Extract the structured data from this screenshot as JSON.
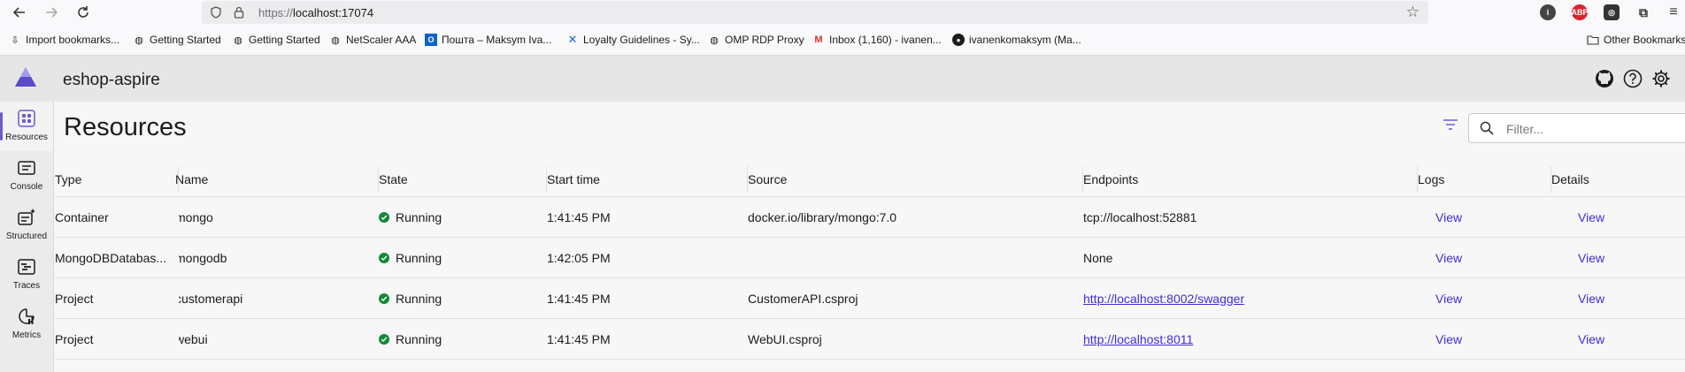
{
  "browser": {
    "url_prefix": "https://",
    "url_host": "localhost:17074",
    "bookmarks": [
      {
        "label": "Import bookmarks...",
        "icon": "import-icon"
      },
      {
        "label": "Getting Started",
        "icon": "globe-icon"
      },
      {
        "label": "Getting Started",
        "icon": "globe-icon"
      },
      {
        "label": "NetScaler AAA",
        "icon": "globe-icon"
      },
      {
        "label": "Пошта – Maksym Iva...",
        "icon": "outlook-icon"
      },
      {
        "label": "Loyalty Guidelines - Sy...",
        "icon": "confluence-icon"
      },
      {
        "label": "OMP RDP Proxy",
        "icon": "globe-icon"
      },
      {
        "label": "Inbox (1,160) - ivanen...",
        "icon": "gmail-icon"
      },
      {
        "label": "ivanenkomaksym (Ma...",
        "icon": "github-icon"
      }
    ],
    "other_bookmarks": "Other Bookmarks",
    "ext_abp": "ABP"
  },
  "app": {
    "title": "eshop-aspire"
  },
  "nav": {
    "items": [
      {
        "label": "Resources",
        "icon": "resources-icon",
        "active": true
      },
      {
        "label": "Console",
        "icon": "console-icon"
      },
      {
        "label": "Structured",
        "icon": "structured-logs-icon"
      },
      {
        "label": "Traces",
        "icon": "traces-icon"
      },
      {
        "label": "Metrics",
        "icon": "metrics-icon"
      }
    ]
  },
  "main": {
    "title": "Resources",
    "filter_placeholder": "Filter...",
    "columns": [
      "Type",
      "Name",
      "State",
      "Start time",
      "Source",
      "Endpoints",
      "Logs",
      "Details"
    ],
    "rows": [
      {
        "type": "Container",
        "name": "mongo",
        "state": "Running",
        "start": "1:41:45 PM",
        "source": "docker.io/library/mongo:7.0",
        "endpoint": "tcp://localhost:52881",
        "endpoint_is_link": false,
        "logs": "View",
        "details": "View"
      },
      {
        "type": "MongoDBDatabas...",
        "name": "mongodb",
        "state": "Running",
        "start": "1:42:05 PM",
        "source": "",
        "endpoint": "None",
        "endpoint_is_link": false,
        "logs": "View",
        "details": "View"
      },
      {
        "type": "Project",
        "name": "customerapi",
        "state": "Running",
        "start": "1:41:45 PM",
        "source": "CustomerAPI.csproj",
        "endpoint": "http://localhost:8002/swagger",
        "endpoint_is_link": true,
        "logs": "View",
        "details": "View"
      },
      {
        "type": "Project",
        "name": "webui",
        "state": "Running",
        "start": "1:41:45 PM",
        "source": "WebUI.csproj",
        "endpoint": "http://localhost:8011",
        "endpoint_is_link": true,
        "logs": "View",
        "details": "View"
      }
    ]
  },
  "colors": {
    "accent": "#6b5bd2",
    "running": "#118a36",
    "link": "#3f2ed6"
  }
}
